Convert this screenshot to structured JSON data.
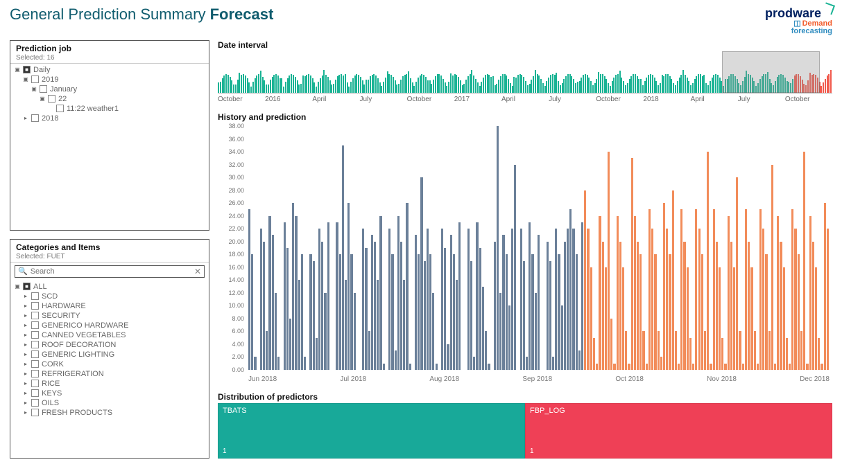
{
  "header": {
    "title_prefix": "General Prediction Summary ",
    "title_bold": "Forecast",
    "brand_name": "prodware",
    "brand_sub1": "Demand",
    "brand_sub2": "forecasting"
  },
  "prediction_panel": {
    "title": "Prediction job",
    "selected_label": "Selected: 16",
    "tree": [
      {
        "level": 0,
        "expand": "▣",
        "checked": true,
        "label": "Daily"
      },
      {
        "level": 1,
        "expand": "▣",
        "checked": false,
        "label": "2019"
      },
      {
        "level": 2,
        "expand": "▣",
        "checked": false,
        "label": "January"
      },
      {
        "level": 3,
        "expand": "▣",
        "checked": false,
        "label": "22"
      },
      {
        "level": 4,
        "expand": "",
        "checked": false,
        "label": "11:22 weather1"
      },
      {
        "level": 1,
        "expand": "▸",
        "checked": false,
        "label": "2018"
      }
    ]
  },
  "categories_panel": {
    "title": "Categories and Items",
    "selected_label": "Selected: FUET",
    "search_placeholder": "Search",
    "tree": [
      {
        "level": 0,
        "expand": "▣",
        "checked": true,
        "label": "ALL"
      },
      {
        "level": 1,
        "expand": "▸",
        "checked": false,
        "label": "SCD"
      },
      {
        "level": 1,
        "expand": "▸",
        "checked": false,
        "label": "HARDWARE"
      },
      {
        "level": 1,
        "expand": "▸",
        "checked": false,
        "label": "SECURITY"
      },
      {
        "level": 1,
        "expand": "▸",
        "checked": false,
        "label": "GENERICO HARDWARE"
      },
      {
        "level": 1,
        "expand": "▸",
        "checked": false,
        "label": "CANNED VEGETABLES"
      },
      {
        "level": 1,
        "expand": "▸",
        "checked": false,
        "label": "ROOF DECORATION"
      },
      {
        "level": 1,
        "expand": "▸",
        "checked": false,
        "label": "GENERIC LIGHTING"
      },
      {
        "level": 1,
        "expand": "▸",
        "checked": false,
        "label": "CORK"
      },
      {
        "level": 1,
        "expand": "▸",
        "checked": false,
        "label": "REFRIGERATION"
      },
      {
        "level": 1,
        "expand": "▸",
        "checked": false,
        "label": "RICE"
      },
      {
        "level": 1,
        "expand": "▸",
        "checked": false,
        "label": "KEYS"
      },
      {
        "level": 1,
        "expand": "▸",
        "checked": false,
        "label": "OILS"
      },
      {
        "level": 1,
        "expand": "▸",
        "checked": false,
        "label": "FRESH PRODUCTS"
      }
    ]
  },
  "date_interval": {
    "title": "Date interval",
    "xlabels": [
      "October",
      "2016",
      "April",
      "July",
      "October",
      "2017",
      "April",
      "July",
      "October",
      "2018",
      "April",
      "July",
      "October"
    ]
  },
  "history": {
    "title": "History and prediction",
    "xlabels": [
      "Jun 2018",
      "Jul 2018",
      "Aug 2018",
      "Sep 2018",
      "Oct 2018",
      "Nov 2018",
      "Dec 2018"
    ],
    "yticks": [
      "0.00",
      "2.00",
      "4.00",
      "6.00",
      "8.00",
      "10.00",
      "12.00",
      "14.00",
      "16.00",
      "18.00",
      "20.00",
      "22.00",
      "24.00",
      "26.00",
      "28.00",
      "30.00",
      "32.00",
      "34.00",
      "36.00",
      "38.00"
    ]
  },
  "distribution": {
    "title": "Distribution of predictors",
    "blocks": [
      {
        "name": "TBATS",
        "count": "1"
      },
      {
        "name": "FBP_LOG",
        "count": "1"
      }
    ]
  },
  "chart_data": [
    {
      "type": "area",
      "title": "Date interval",
      "x_range": [
        "2015-10",
        "2018-12"
      ],
      "note": "Dense daily series; teal = history, red overlay at right = forecast; grey box marks selected Jun–Dec 2018 window",
      "selection": {
        "start": "2018-06",
        "end": "2018-12"
      },
      "ylim": [
        0,
        40
      ]
    },
    {
      "type": "bar",
      "title": "History and prediction",
      "xlabel": "",
      "ylabel": "",
      "ylim": [
        0,
        38
      ],
      "categories_note": "Daily bars Jun 2018 – Dec 2018; mid-Sep split history→prediction",
      "series": [
        {
          "name": "History",
          "color": "#6b8099",
          "values": [
            25,
            18,
            2,
            0,
            22,
            20,
            6,
            24,
            21,
            12,
            2,
            0,
            23,
            19,
            8,
            26,
            24,
            14,
            18,
            2,
            0,
            18,
            17,
            5,
            22,
            20,
            12,
            23,
            0,
            0,
            23,
            18,
            35,
            14,
            26,
            18,
            12,
            0,
            0,
            22,
            19,
            6,
            21,
            20,
            14,
            24,
            1,
            0,
            22,
            18,
            3,
            24,
            20,
            14,
            26,
            1,
            0,
            21,
            18,
            30,
            17,
            22,
            18,
            12,
            1,
            0,
            22,
            19,
            4,
            21,
            18,
            14,
            23,
            0,
            0,
            22,
            17,
            2,
            23,
            19,
            13,
            6,
            1,
            0,
            20,
            38,
            12,
            21,
            18,
            10,
            22,
            32,
            0,
            22,
            17,
            2,
            23,
            18,
            12,
            21,
            0,
            0,
            20,
            17,
            2,
            22,
            18,
            10,
            20,
            22,
            25,
            22,
            18,
            3,
            23
          ]
        },
        {
          "name": "Prediction",
          "color": "#f28c5a",
          "values": [
            28,
            22,
            16,
            5,
            1,
            24,
            20,
            16,
            34,
            8,
            1,
            24,
            20,
            16,
            6,
            1,
            33,
            24,
            20,
            18,
            6,
            1,
            25,
            22,
            18,
            6,
            2,
            26,
            22,
            18,
            28,
            6,
            1,
            25,
            20,
            16,
            5,
            1,
            25,
            22,
            18,
            6,
            34,
            1,
            25,
            20,
            16,
            5,
            1,
            24,
            20,
            16,
            30,
            6,
            1,
            25,
            20,
            16,
            6,
            1,
            25,
            22,
            18,
            6,
            32,
            1,
            24,
            20,
            16,
            5,
            1,
            25,
            22,
            18,
            6,
            34,
            1,
            24,
            20,
            16,
            5,
            1,
            26,
            22
          ]
        }
      ]
    },
    {
      "type": "bar",
      "title": "Distribution of predictors",
      "categories": [
        "TBATS",
        "FBP_LOG"
      ],
      "values": [
        1,
        1
      ],
      "colors": [
        "#18a999",
        "#ef4056"
      ]
    }
  ]
}
